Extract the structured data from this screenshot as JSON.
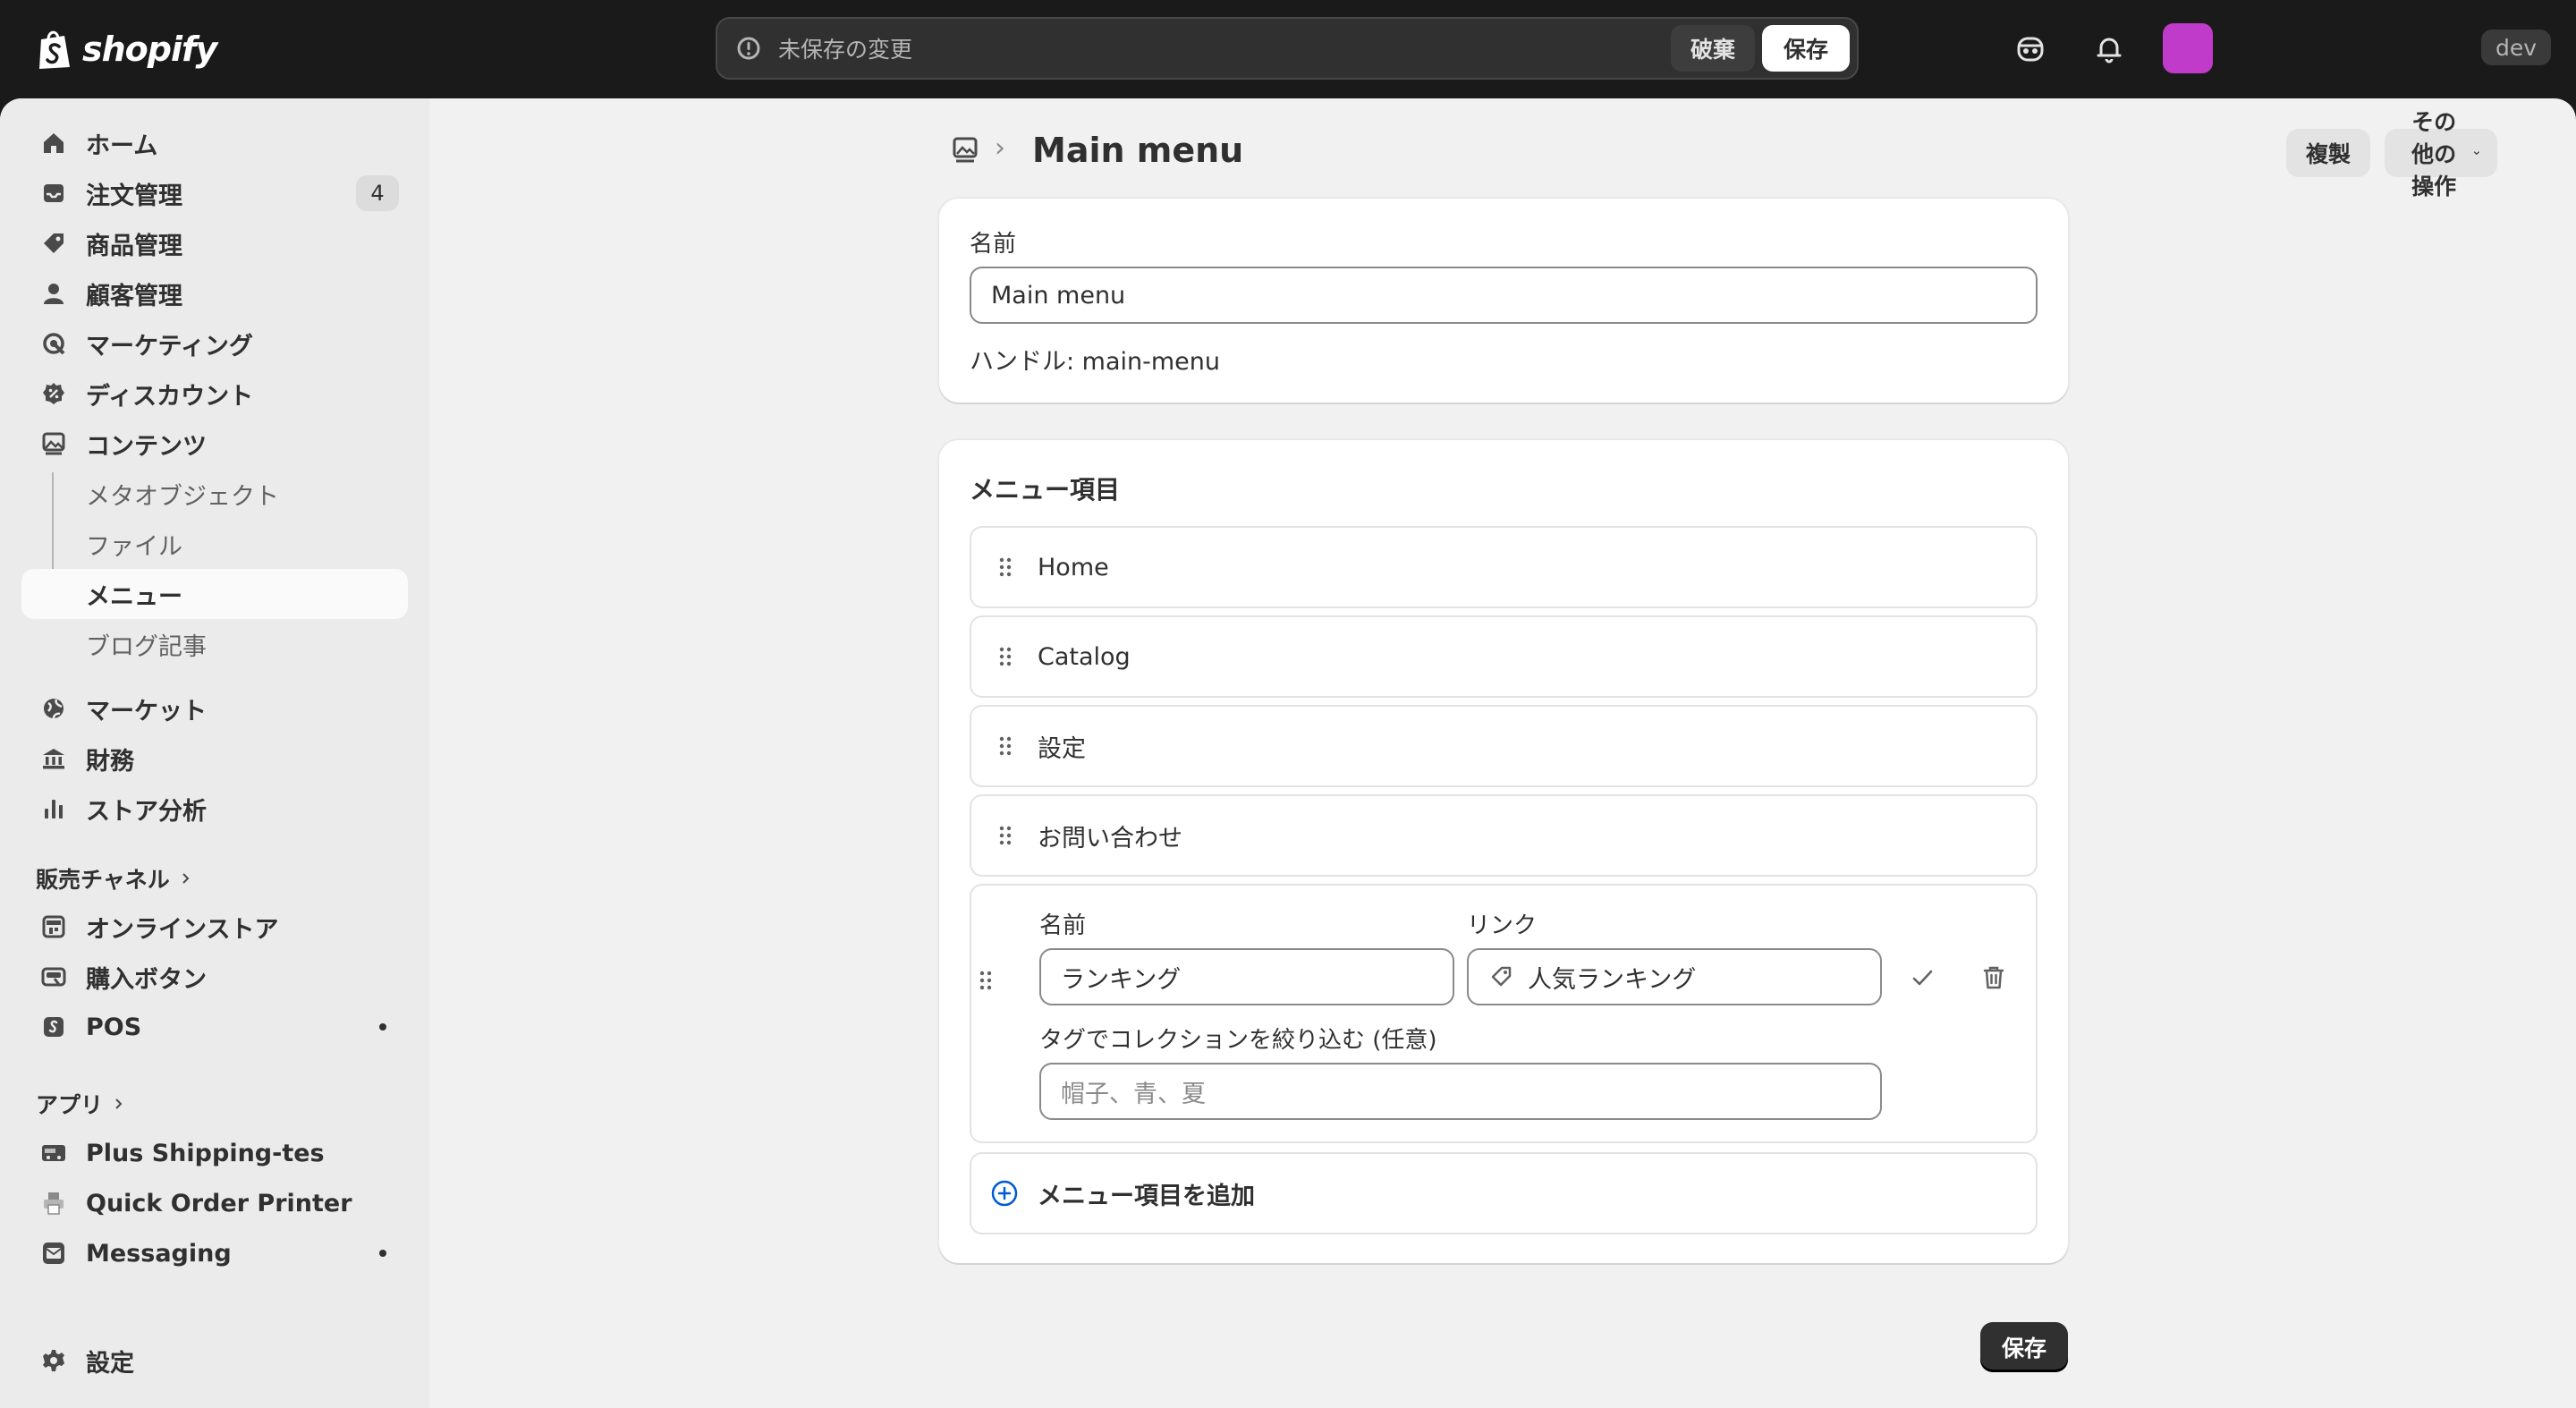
{
  "brand": {
    "name": "shopify",
    "accent": "#c03bc9"
  },
  "topbar": {
    "unsaved_text": "未保存の変更",
    "discard_label": "破棄",
    "save_label": "保存",
    "dev_label": "dev"
  },
  "sidebar": {
    "items": [
      {
        "label": "ホーム",
        "icon": "home-icon"
      },
      {
        "label": "注文管理",
        "icon": "inbox-icon",
        "badge": "4"
      },
      {
        "label": "商品管理",
        "icon": "tag-icon"
      },
      {
        "label": "顧客管理",
        "icon": "person-icon"
      },
      {
        "label": "マーケティング",
        "icon": "target-icon"
      },
      {
        "label": "ディスカウント",
        "icon": "discount-icon"
      },
      {
        "label": "コンテンツ",
        "icon": "image-icon"
      }
    ],
    "content_sub": [
      {
        "label": "メタオブジェクト"
      },
      {
        "label": "ファイル"
      },
      {
        "label": "メニュー",
        "active": true
      },
      {
        "label": "ブログ記事"
      }
    ],
    "items2": [
      {
        "label": "マーケット",
        "icon": "globe-icon"
      },
      {
        "label": "財務",
        "icon": "bank-icon"
      },
      {
        "label": "ストア分析",
        "icon": "chart-icon"
      }
    ],
    "sales_channels_label": "販売チャネル",
    "channels": [
      {
        "label": "オンラインストア",
        "icon": "store-icon"
      },
      {
        "label": "購入ボタン",
        "icon": "buy-button-icon"
      },
      {
        "label": "POS",
        "icon": "pos-icon"
      }
    ],
    "apps_label": "アプリ",
    "apps": [
      {
        "label": "Plus Shipping-tes",
        "icon": "truck-icon"
      },
      {
        "label": "Quick Order Printer",
        "icon": "printer-icon"
      },
      {
        "label": "Messaging",
        "icon": "mail-icon"
      }
    ],
    "settings_label": "設定"
  },
  "page": {
    "title": "Main menu",
    "duplicate_label": "複製",
    "more_actions_label": "その他の操作",
    "name_label": "名前",
    "name_value": "Main menu",
    "handle_text": "ハンドル: main-menu",
    "menu_items_title": "メニュー項目",
    "menu_items": [
      "Home",
      "Catalog",
      "設定",
      "お問い合わせ"
    ],
    "edit_item": {
      "name_label": "名前",
      "name_value": "ランキング",
      "link_label": "リンク",
      "link_value": "人気ランキング",
      "tags_label": "タグでコレクションを絞り込む (任意)",
      "tags_placeholder": "帽子、青、夏"
    },
    "add_item_label": "メニュー項目を追加",
    "save_label": "保存"
  }
}
